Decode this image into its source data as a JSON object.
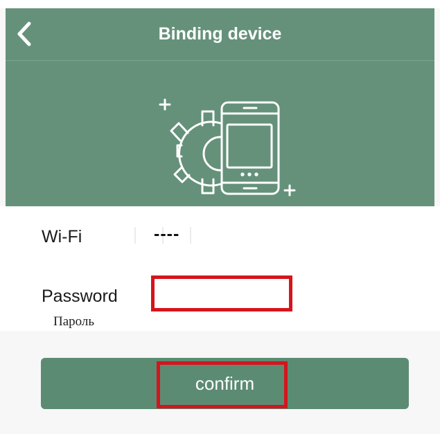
{
  "navbar": {
    "title": "Binding device",
    "back_icon": "chevron-left-icon"
  },
  "illustration": {
    "icon": "phone-gear-icon"
  },
  "form": {
    "wifi_label": "Wi-Fi",
    "wifi_value": "----",
    "password_label": "Password",
    "password_sublabel": "Пароль",
    "password_value": ""
  },
  "actions": {
    "confirm_label": "confirm"
  },
  "colors": {
    "header_green": "#65917a",
    "button_green": "#5c8b73",
    "highlight_red": "#d4151d"
  }
}
